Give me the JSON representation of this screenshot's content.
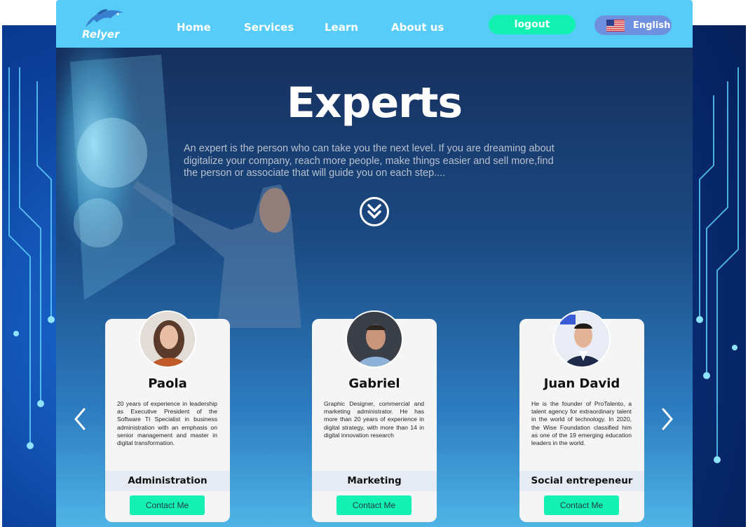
{
  "brand": {
    "logo_text": "Relyer"
  },
  "nav": {
    "links": [
      "Home",
      "Services",
      "Learn",
      "About us"
    ],
    "logout_label": "logout",
    "language_label": "English"
  },
  "hero": {
    "title": "Experts",
    "description": "An expert is the person who can take you the next level. If you are dreaming about digitalize your company, reach more people, make things easier and sell more,find the person or associate that will guide you on each step...."
  },
  "experts": [
    {
      "name": "Paola",
      "bio": "20 years of experience in leadership as Executive President of the Software TI Specialist in business administration with an emphasis on senior management and master in digital transformation.",
      "role": "Administration",
      "contact_label": "Contact Me"
    },
    {
      "name": "Gabriel",
      "bio": "Graphic Designer, commercial and marketing administrator. He has more than 20 years of experience in digital strategy, with more than 14 in digital innovation research",
      "role": "Marketing",
      "contact_label": "Contact Me"
    },
    {
      "name": "Juan David",
      "bio": "He is the founder of ProTalento, a talent agency for extraordinary talent in the world of technology. In 2020, the Wise Foundation classified him as one of the 19 emerging education leaders in the world.",
      "role": "Social entrepeneur",
      "contact_label": "Contact Me"
    }
  ],
  "colors": {
    "navbar": "#57ccf9",
    "logout": "#13f1b1",
    "language": "#6f90de",
    "contact": "#14f1b3",
    "card": "#f5f5f5"
  }
}
